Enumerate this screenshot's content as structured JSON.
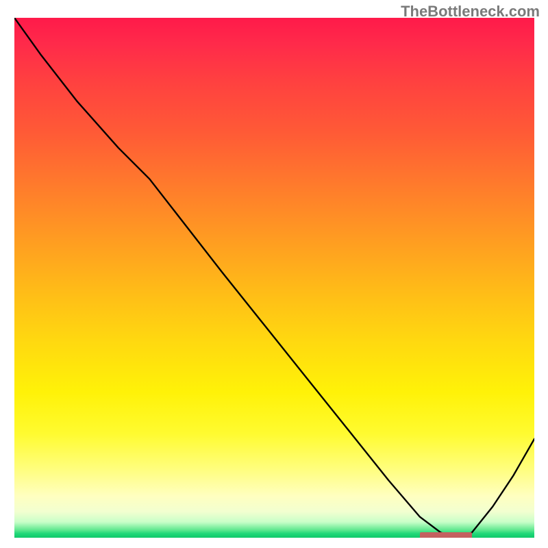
{
  "watermark": "TheBottleneck.com",
  "chart_data": {
    "type": "line",
    "title": "",
    "xlabel": "",
    "ylabel": "",
    "xlim": [
      0,
      100
    ],
    "ylim": [
      0,
      100
    ],
    "series": [
      {
        "name": "curve",
        "x": [
          0,
          5,
          12,
          20,
          26,
          33,
          40,
          48,
          56,
          64,
          72,
          78,
          82,
          85,
          88,
          92,
          96,
          100
        ],
        "values": [
          100,
          93,
          84,
          75,
          69,
          60,
          51,
          41,
          31,
          21,
          11,
          4,
          1,
          0,
          1,
          6,
          12,
          19
        ]
      }
    ],
    "marker_band": {
      "x_start": 78,
      "x_end": 88,
      "y": 0.2
    },
    "color_gradient_note": "background vertical gradient red→orange→yellow→green representing bottleneck severity"
  }
}
